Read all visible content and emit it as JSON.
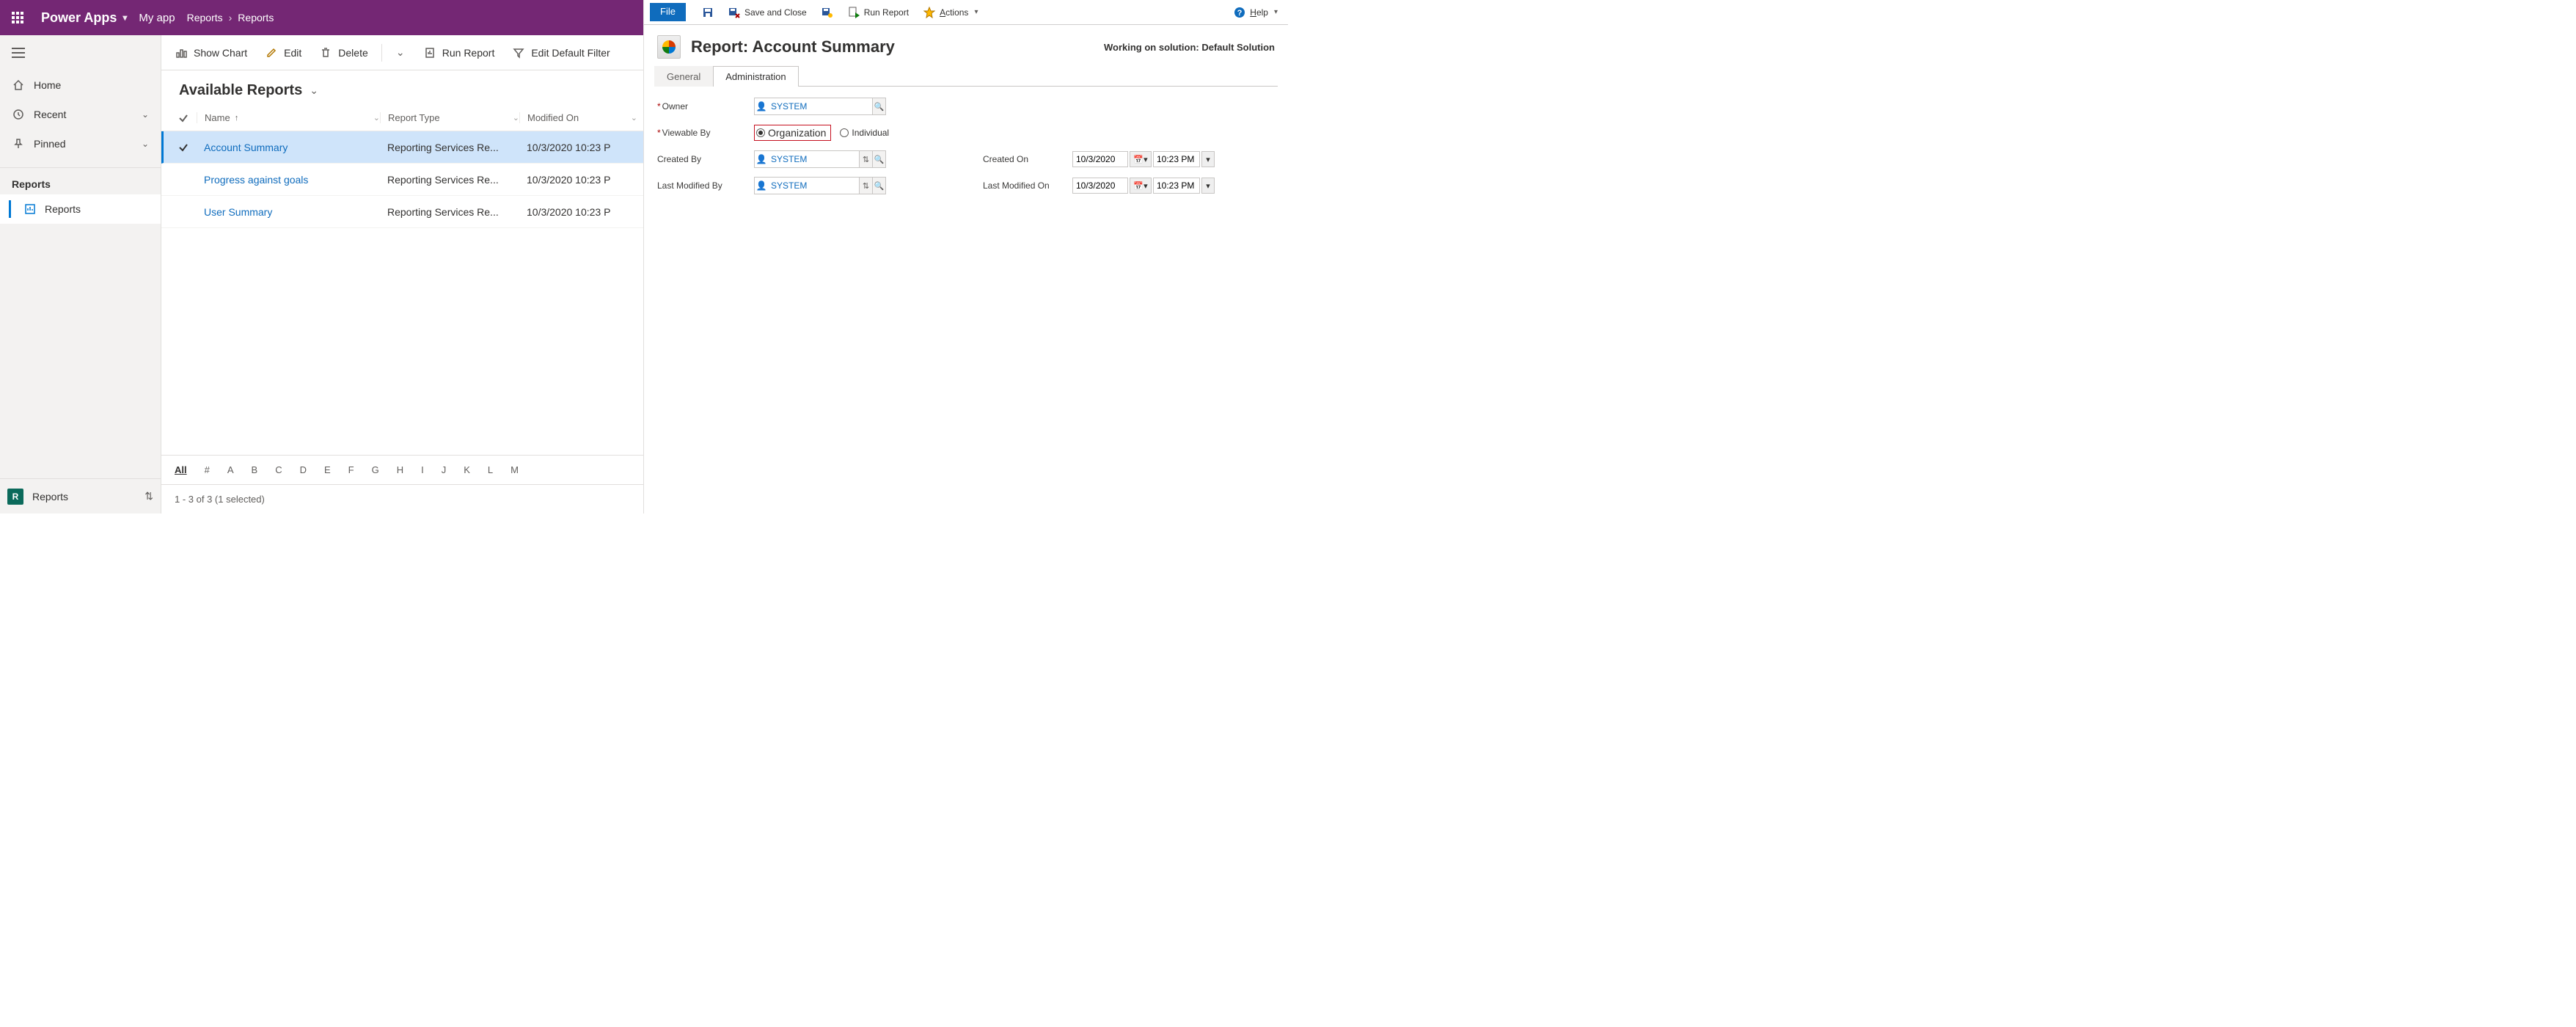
{
  "header": {
    "brand": "Power Apps",
    "app_name": "My app",
    "crumbs": [
      "Reports",
      "Reports"
    ]
  },
  "sidebar": {
    "home": "Home",
    "recent": "Recent",
    "pinned": "Pinned",
    "section": "Reports",
    "active_item": "Reports",
    "footer_env_letter": "R",
    "footer_label": "Reports"
  },
  "cmdbar": {
    "show_chart": "Show Chart",
    "edit": "Edit",
    "delete": "Delete",
    "run_report": "Run Report",
    "edit_default_filter": "Edit Default Filter"
  },
  "view": {
    "title": "Available Reports",
    "columns": {
      "name": "Name",
      "type": "Report Type",
      "modified": "Modified On"
    },
    "rows": [
      {
        "name": "Account Summary",
        "type": "Reporting Services Re...",
        "modified": "10/3/2020 10:23 P",
        "selected": true
      },
      {
        "name": "Progress against goals",
        "type": "Reporting Services Re...",
        "modified": "10/3/2020 10:23 P",
        "selected": false
      },
      {
        "name": "User Summary",
        "type": "Reporting Services Re...",
        "modified": "10/3/2020 10:23 P",
        "selected": false
      }
    ],
    "alpha": [
      "All",
      "#",
      "A",
      "B",
      "C",
      "D",
      "E",
      "F",
      "G",
      "H",
      "I",
      "J",
      "K",
      "L",
      "M"
    ],
    "status": "1 - 3 of 3 (1 selected)"
  },
  "detail": {
    "ribbon": {
      "file": "File",
      "save_and_close": "Save and Close",
      "run_report": "Run Report",
      "actions": "Actions",
      "help": "Help"
    },
    "title": "Report: Account Summary",
    "solution_note": "Working on solution: Default Solution",
    "tabs": {
      "general": "General",
      "administration": "Administration"
    },
    "fields": {
      "owner_label": "Owner",
      "owner_value": "SYSTEM",
      "viewable_label": "Viewable By",
      "viewable_org": "Organization",
      "viewable_ind": "Individual",
      "created_by_label": "Created By",
      "created_by_value": "SYSTEM",
      "last_modified_by_label": "Last Modified By",
      "last_modified_by_value": "SYSTEM",
      "created_on_label": "Created On",
      "created_on_date": "10/3/2020",
      "created_on_time": "10:23 PM",
      "last_modified_on_label": "Last Modified On",
      "last_modified_on_date": "10/3/2020",
      "last_modified_on_time": "10:23 PM"
    }
  }
}
